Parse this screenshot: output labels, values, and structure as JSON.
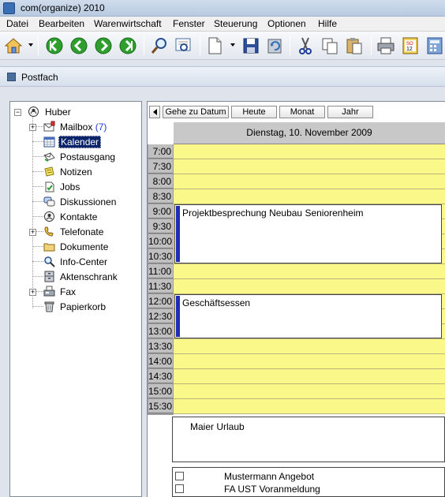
{
  "window": {
    "title": "com(organize) 2010"
  },
  "menu": [
    "Datei",
    "Bearbeiten",
    "Warenwirtschaft",
    "Fenster",
    "Steuerung",
    "Optionen",
    "Hilfe"
  ],
  "panel": {
    "title": "Postfach"
  },
  "tree": {
    "root": "Huber",
    "items": [
      {
        "label": "Mailbox",
        "count": "(7)"
      },
      {
        "label": "Kalender"
      },
      {
        "label": "Postausgang"
      },
      {
        "label": "Notizen"
      },
      {
        "label": "Jobs"
      },
      {
        "label": "Diskussionen"
      },
      {
        "label": "Kontakte"
      },
      {
        "label": "Telefonate"
      },
      {
        "label": "Dokumente"
      },
      {
        "label": "Info-Center"
      },
      {
        "label": "Aktenschrank"
      },
      {
        "label": "Fax"
      },
      {
        "label": "Papierkorb"
      }
    ]
  },
  "calendar": {
    "buttons": {
      "goto": "Gehe zu Datum",
      "today": "Heute",
      "month": "Monat",
      "year": "Jahr"
    },
    "date": "Dienstag, 10. November 2009",
    "times": [
      "7:00",
      "7:30",
      "8:00",
      "8:30",
      "9:00",
      "9:30",
      "10:00",
      "10:30",
      "11:00",
      "11:30",
      "12:00",
      "12:30",
      "13:00",
      "13:30",
      "14:00",
      "14:30",
      "15:00",
      "15:30"
    ],
    "appointments": [
      {
        "title": "Projektbesprechung Neubau Seniorenheim",
        "start": "9:00",
        "end": "11:00"
      },
      {
        "title": "Geschäftsessen",
        "start": "12:00",
        "end": "13:30"
      }
    ],
    "allday": "Maier Urlaub",
    "tasks": [
      {
        "title": "Mustermann Angebot",
        "done": false
      },
      {
        "title": "FA UST Voranmeldung",
        "done": false
      }
    ]
  },
  "icons": {
    "toolbar": [
      "home-icon",
      "back-icon",
      "back-alt-icon",
      "forward-icon",
      "forward-alt-icon",
      "search-icon",
      "preview-icon",
      "new-document-icon",
      "save-icon",
      "refresh-icon",
      "cut-icon",
      "copy-icon",
      "paste-icon",
      "print-icon",
      "calendar-icon",
      "calculator-icon"
    ]
  },
  "colors": {
    "slot": "#fbf88a",
    "appointment_bar": "#1e2cb8",
    "selection": "#0a246a",
    "nav_green": "#2f9e2f"
  }
}
